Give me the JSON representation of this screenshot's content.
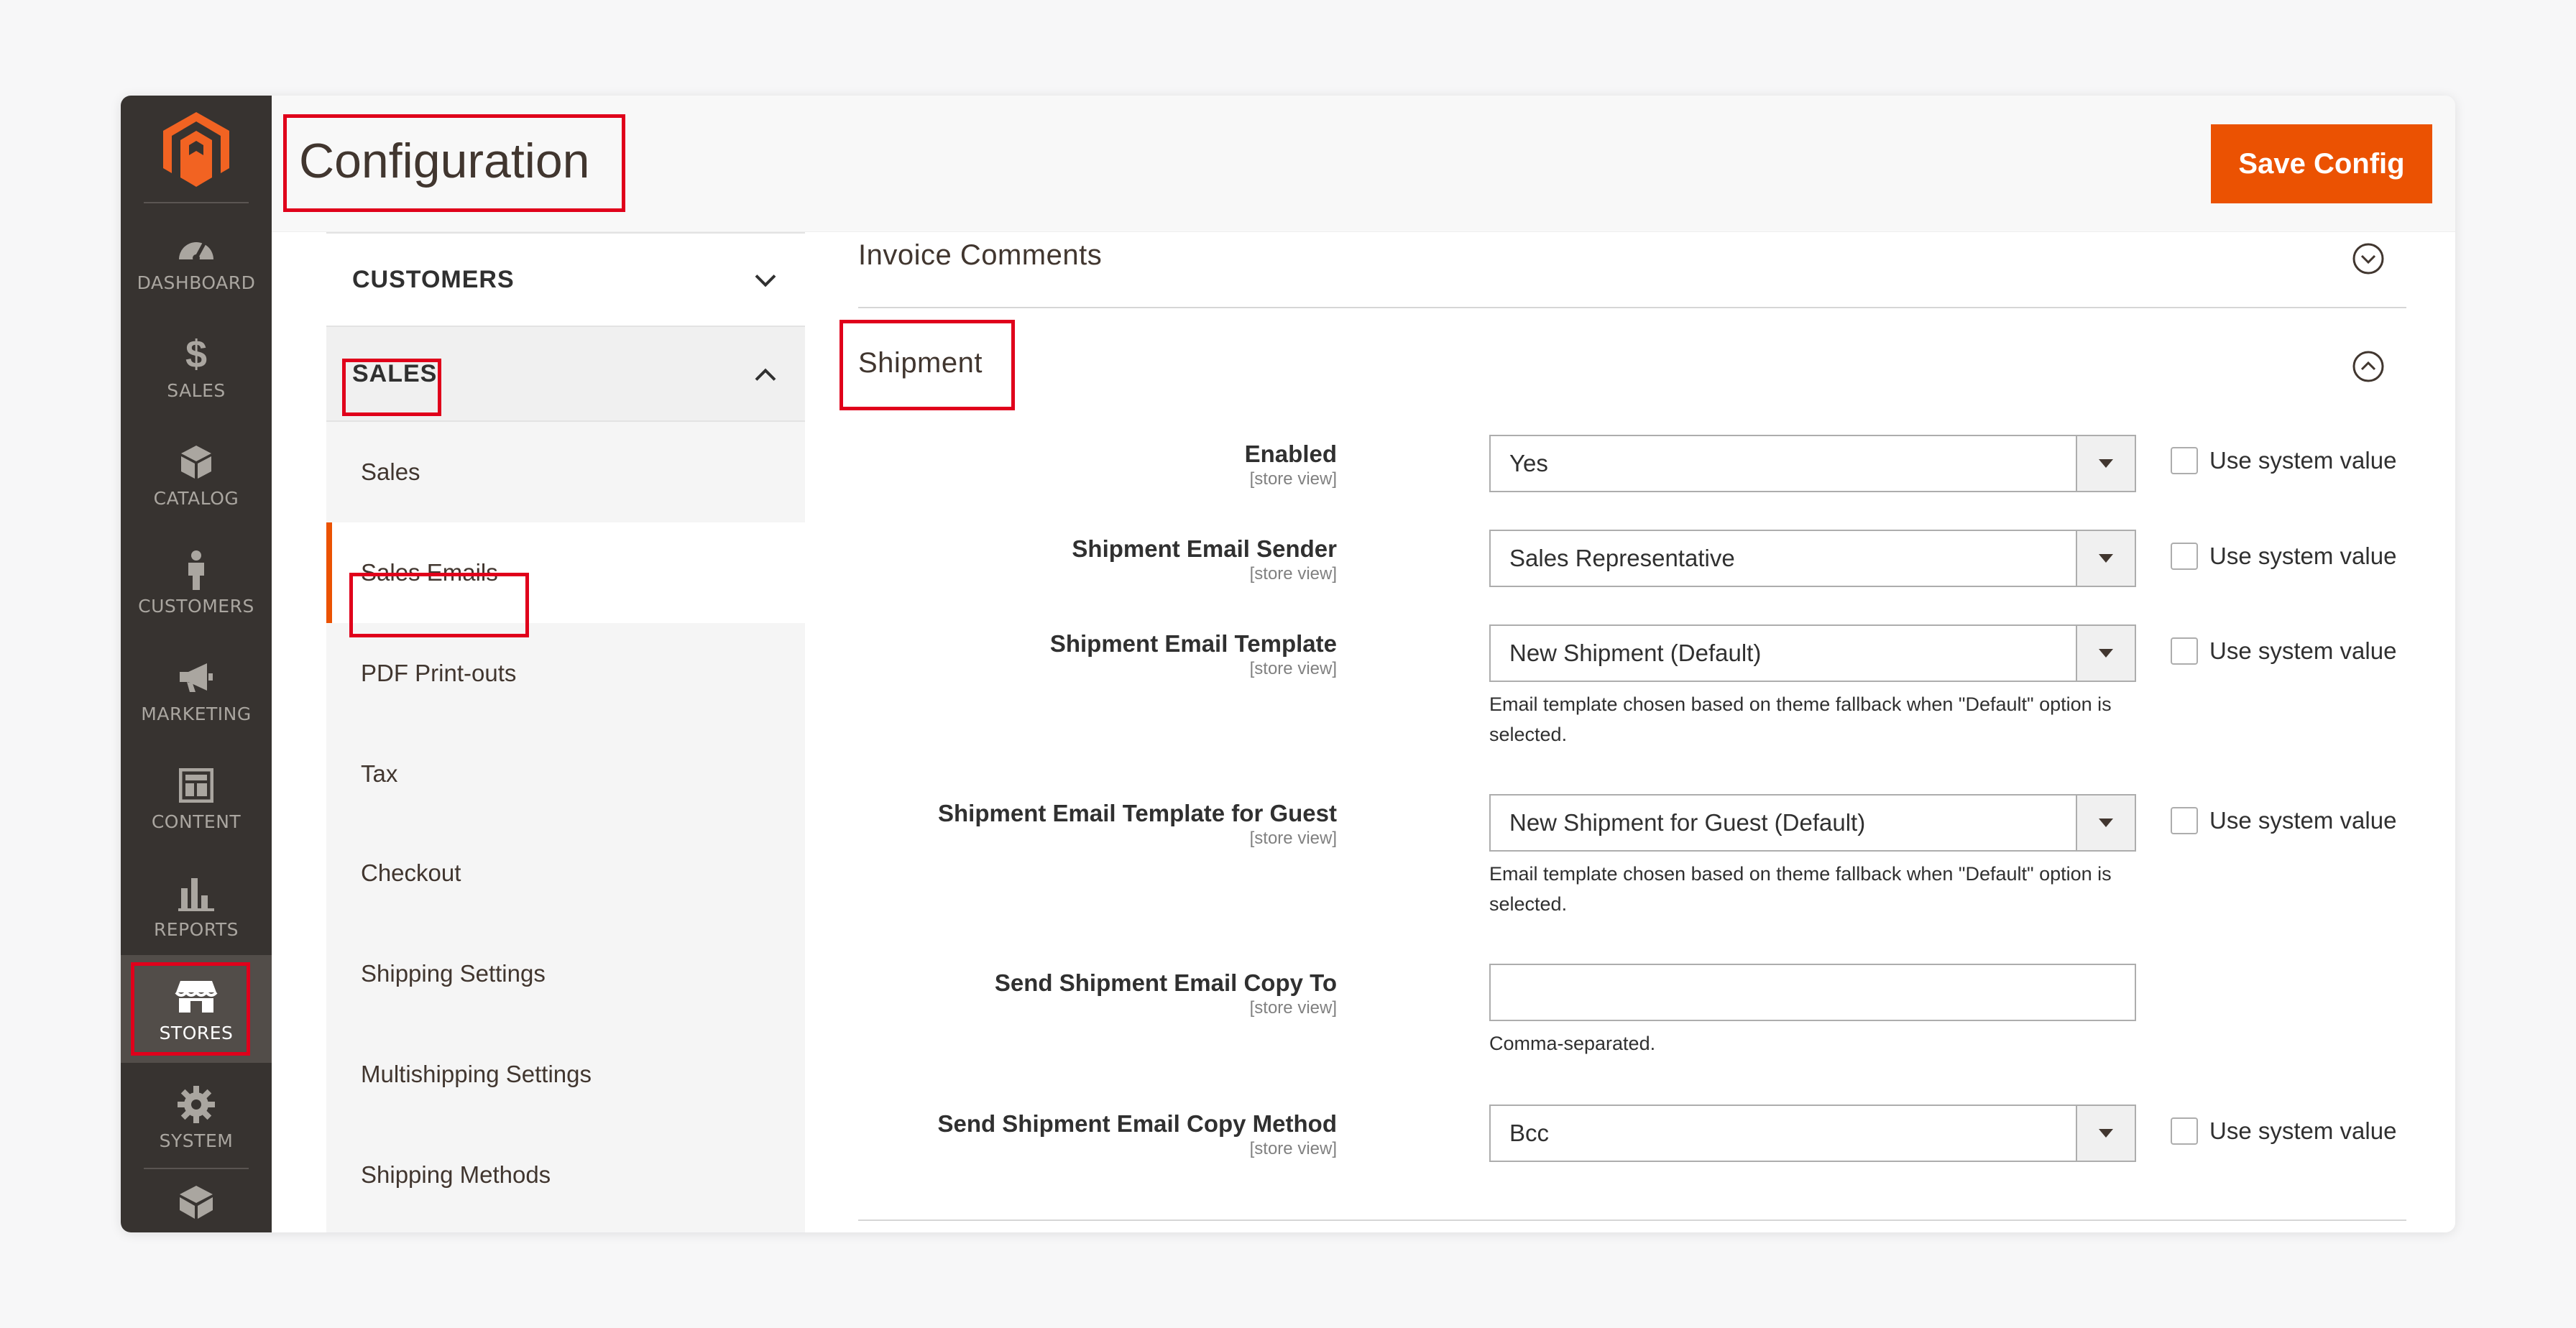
{
  "brand_color": "#eb5202",
  "menu_items": [
    {
      "label": "DASHBOARD",
      "icon": "dashboard-icon"
    },
    {
      "label": "SALES",
      "icon": "dollar-icon"
    },
    {
      "label": "CATALOG",
      "icon": "cube-icon"
    },
    {
      "label": "CUSTOMERS",
      "icon": "person-icon"
    },
    {
      "label": "MARKETING",
      "icon": "megaphone-icon"
    },
    {
      "label": "CONTENT",
      "icon": "layout-icon"
    },
    {
      "label": "REPORTS",
      "icon": "bar-chart-icon"
    },
    {
      "label": "STORES",
      "icon": "storefront-icon",
      "active": true
    },
    {
      "label": "SYSTEM",
      "icon": "gear-icon"
    }
  ],
  "header": {
    "title": "Configuration",
    "save_label": "Save Config"
  },
  "tabs": {
    "customers_label": "CUSTOMERS",
    "sales_label": "SALES",
    "items": [
      "Sales",
      "Sales Emails",
      "PDF Print-outs",
      "Tax",
      "Checkout",
      "Shipping Settings",
      "Multishipping Settings",
      "Shipping Methods"
    ],
    "active_item": "Sales Emails"
  },
  "content": {
    "prev_section": "Invoice Comments",
    "section": "Shipment",
    "scope": "[store view]",
    "system_value_label": "Use system value",
    "fields": [
      {
        "label": "Enabled",
        "value": "Yes"
      },
      {
        "label": "Shipment Email Sender",
        "value": "Sales Representative"
      },
      {
        "label": "Shipment Email Template",
        "value": "New Shipment (Default)",
        "note": "Email template chosen based on theme fallback when \"Default\" option is selected."
      },
      {
        "label": "Shipment Email Template for Guest",
        "value": "New Shipment for Guest (Default)",
        "note": "Email template chosen based on theme fallback when \"Default\" option is selected."
      },
      {
        "label": "Send Shipment Email Copy To",
        "value": "",
        "note": "Comma-separated."
      },
      {
        "label": "Send Shipment Email Copy Method",
        "value": "Bcc"
      }
    ]
  }
}
